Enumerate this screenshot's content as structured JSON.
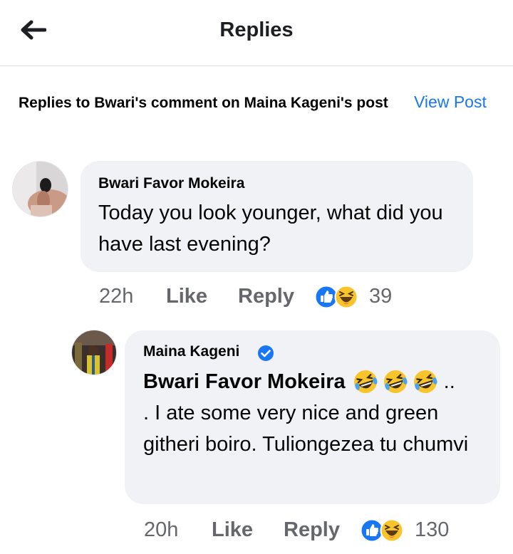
{
  "header": {
    "title": "Replies",
    "back_icon": "arrow-left-icon"
  },
  "context": {
    "text": "Replies to Bwari's comment on Maina Kageni's post",
    "view_post_label": "View Post"
  },
  "colors": {
    "link": "#1877f2",
    "muted": "#65676b",
    "bubble": "#f0f2f5",
    "like_blue": "#1877f2",
    "haha_yellow": "#f7c52b"
  },
  "comments": [
    {
      "author": "Bwari Favor Mokeira",
      "text": "Today you look younger, what did you have last evening?",
      "time": "22h",
      "like_label": "Like",
      "reply_label": "Reply",
      "reaction_count": "39",
      "reactions": [
        "like-icon",
        "haha-icon"
      ]
    },
    {
      "author": "Maina Kageni",
      "verified": true,
      "mention": "Bwari Favor Mokeira",
      "mention_suffix": "..",
      "text": ". I ate some very nice and green githeri boiro. Tuliongezea tu chumvi",
      "emojis": [
        "laughing-emoji",
        "laughing-emoji",
        "laughing-emoji"
      ],
      "time": "20h",
      "like_label": "Like",
      "reply_label": "Reply",
      "reaction_count": "130",
      "reactions": [
        "like-icon",
        "haha-icon"
      ]
    }
  ]
}
